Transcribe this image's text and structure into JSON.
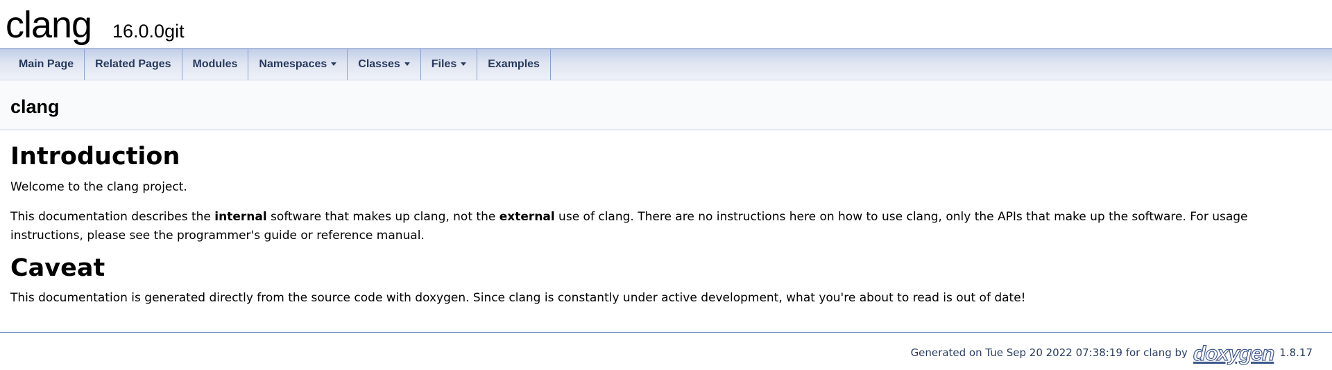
{
  "project": {
    "name": "clang",
    "number": "16.0.0git"
  },
  "navbar": {
    "items": [
      {
        "label": "Main Page",
        "has_dropdown": false
      },
      {
        "label": "Related Pages",
        "has_dropdown": false
      },
      {
        "label": "Modules",
        "has_dropdown": false
      },
      {
        "label": "Namespaces",
        "has_dropdown": true
      },
      {
        "label": "Classes",
        "has_dropdown": true
      },
      {
        "label": "Files",
        "has_dropdown": true
      },
      {
        "label": "Examples",
        "has_dropdown": false
      }
    ]
  },
  "header": {
    "title": "clang"
  },
  "content": {
    "intro_heading": "Introduction",
    "welcome": "Welcome to the clang project.",
    "desc_part1": "This documentation describes the ",
    "desc_bold1": "internal",
    "desc_part2": " software that makes up clang, not the ",
    "desc_bold2": "external",
    "desc_part3": " use of clang. There are no instructions here on how to use clang, only the APIs that make up the software. For usage instructions, please see the programmer's guide or reference manual.",
    "caveat_heading": "Caveat",
    "caveat_text": "This documentation is generated directly from the source code with doxygen. Since clang is constantly under active development, what you're about to read is out of date!"
  },
  "footer": {
    "generated": "Generated on Tue Sep 20 2022 07:38:19 for clang by",
    "logo_text": "doxygen",
    "version": "1.8.17"
  },
  "colors": {
    "nav_text": "#283a5d",
    "nav_border": "#8aa0cc",
    "footer_rule": "#4a6aaa",
    "header_bg": "#f9fafc"
  }
}
